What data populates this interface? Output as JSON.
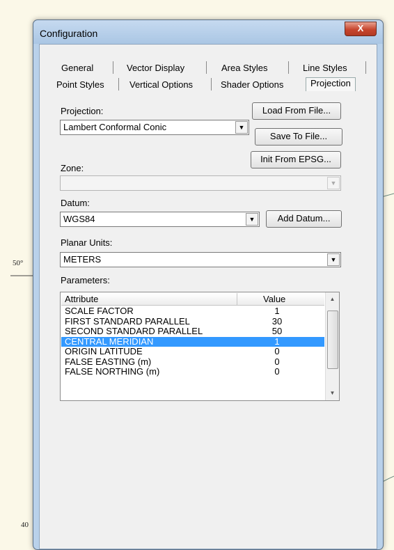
{
  "background": {
    "label_left": "50°",
    "label_bottom": "40"
  },
  "window": {
    "title": "Configuration",
    "close_label": "X"
  },
  "tabs": {
    "row1": [
      "General",
      "Vector Display",
      "Area Styles",
      "Line Styles"
    ],
    "row2": [
      "Point Styles",
      "Vertical Options",
      "Shader Options",
      "Projection"
    ],
    "active": "Projection"
  },
  "projection": {
    "label": "Projection:",
    "value": "Lambert Conformal Conic",
    "load_button": "Load From File...",
    "save_button": "Save To File...",
    "init_button": "Init From EPSG..."
  },
  "zone": {
    "label": "Zone:",
    "value": ""
  },
  "datum": {
    "label": "Datum:",
    "value": "WGS84",
    "add_button": "Add Datum..."
  },
  "planar_units": {
    "label": "Planar Units:",
    "value": "METERS"
  },
  "parameters": {
    "label": "Parameters:",
    "columns": [
      "Attribute",
      "Value"
    ],
    "rows": [
      {
        "attribute": "SCALE FACTOR",
        "value": "1"
      },
      {
        "attribute": "FIRST STANDARD PARALLEL",
        "value": "30"
      },
      {
        "attribute": "SECOND STANDARD PARALLEL",
        "value": "50"
      },
      {
        "attribute": "CENTRAL MERIDIAN",
        "value": "1"
      },
      {
        "attribute": "ORIGIN LATITUDE",
        "value": "0"
      },
      {
        "attribute": "FALSE EASTING (m)",
        "value": "0"
      },
      {
        "attribute": "FALSE NORTHING (m)",
        "value": "0"
      }
    ],
    "selected_row": "CENTRAL MERIDIAN"
  },
  "colors": {
    "selection": "#3399ff",
    "title_bar": "#b9d1ea",
    "close": "#c7462e"
  }
}
